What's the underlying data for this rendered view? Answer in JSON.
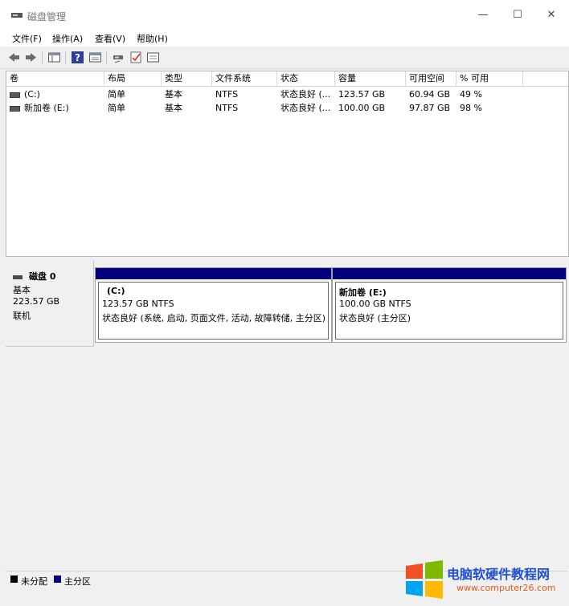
{
  "window": {
    "title": "磁盘管理",
    "controls": {
      "minimize": "—",
      "maximize": "☐",
      "close": "✕"
    }
  },
  "menu": [
    "文件(F)",
    "操作(A)",
    "查看(V)",
    "帮助(H)"
  ],
  "toolbar": {
    "icons": [
      "back-arrow-icon",
      "forward-arrow-icon",
      "console-tree-icon",
      "help-icon",
      "properties-icon",
      "connect-icon",
      "check-icon",
      "show-view-icon"
    ],
    "help_glyph": "?"
  },
  "volume_table": {
    "columns": [
      "卷",
      "布局",
      "类型",
      "文件系统",
      "状态",
      "容量",
      "可用空间",
      "% 可用"
    ],
    "rows": [
      [
        "(C:)",
        "简单",
        "基本",
        "NTFS",
        "状态良好 (...",
        "123.57 GB",
        "60.94 GB",
        "49 %"
      ],
      [
        "新加卷 (E:)",
        "简单",
        "基本",
        "NTFS",
        "状态良好 (...",
        "100.00 GB",
        "97.87 GB",
        "98 %"
      ]
    ]
  },
  "disk": {
    "name": "磁盘 0",
    "type": "基本",
    "size": "223.57 GB",
    "status": "联机"
  },
  "partitions": [
    {
      "name": "(C:)",
      "size_fs": "123.57 GB NTFS",
      "status": "状态良好 (系统, 启动, 页面文件, 活动, 故障转储, 主分区)"
    },
    {
      "name": "新加卷  (E:)",
      "size_fs": "100.00 GB NTFS",
      "status": "状态良好 (主分区)"
    }
  ],
  "legend": [
    {
      "label": "未分配",
      "color": "#000000"
    },
    {
      "label": "主分区",
      "color": "#00007e"
    }
  ],
  "watermark": {
    "title": "电脑软硬件教程网",
    "url": "www.computer26.com"
  },
  "colors": {
    "primary_partition_bar": "#00007e",
    "window_bg": "#f0f0f0"
  }
}
